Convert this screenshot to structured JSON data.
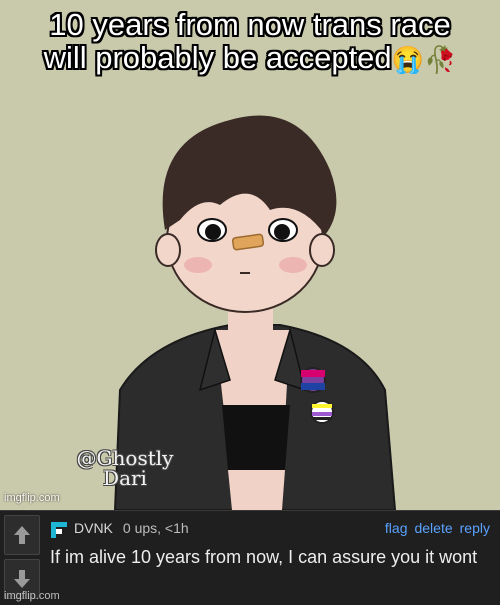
{
  "meme": {
    "caption_line1": "10 years from now trans race",
    "caption_line2": "will probably be accepted",
    "caption_emojis": "😭🥀",
    "watermark": "imgflip.com",
    "artist_signature": "@Ghostly Dari"
  },
  "comment": {
    "username": "DVNK",
    "ups": "0 ups, <1h",
    "actions": {
      "flag": "flag",
      "delete": "delete",
      "reply": "reply"
    },
    "text": "If im alive 10 years from now, I can assure you it wont",
    "watermark": "imgflip.com"
  },
  "colors": {
    "meme_background": "#c9c9ac",
    "comment_background": "#1f1f1f",
    "link_blue": "#5aa2ff",
    "avatar_accent": "#1fb6d6"
  },
  "icons": {
    "upvote": "arrow-up-icon",
    "downvote": "arrow-down-icon",
    "avatar": "user-avatar-icon"
  }
}
